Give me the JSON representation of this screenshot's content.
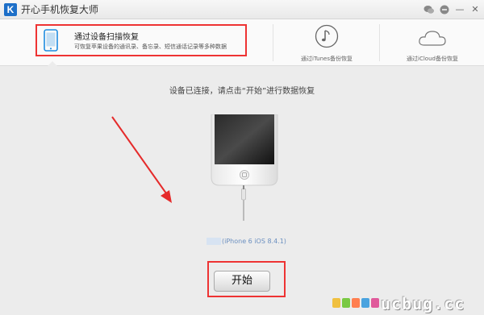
{
  "window": {
    "logo_text": "K",
    "title": "开心手机恢复大师",
    "controls": [
      "wechat-icon",
      "chat-icon",
      "minimize-icon",
      "close-icon"
    ],
    "minimize_glyph": "—",
    "close_glyph": "✕"
  },
  "tabs": {
    "device": {
      "title": "通过设备扫描恢复",
      "desc": "可恢复苹果设备的通讯录、备忘录、短信通话记录等多种数据"
    },
    "itunes": {
      "label": "通过iTunes备份恢复"
    },
    "icloud": {
      "label": "通过iCloud备份恢复"
    }
  },
  "main": {
    "instruction": "设备已连接，请点击“开始”进行数据恢复",
    "device_name": "(iPhone 6 iOS 8.4.1)",
    "start_button": "开始"
  },
  "watermark": {
    "text": "ucbug.cc",
    "dot_colors": [
      "#f0c040",
      "#7ac943",
      "#ff7f50",
      "#4aa3df",
      "#e05a9b"
    ]
  },
  "colors": {
    "highlight_box": "#ee3333",
    "arrow": "#e52b2b",
    "accent_blue": "#1d6fc8"
  }
}
